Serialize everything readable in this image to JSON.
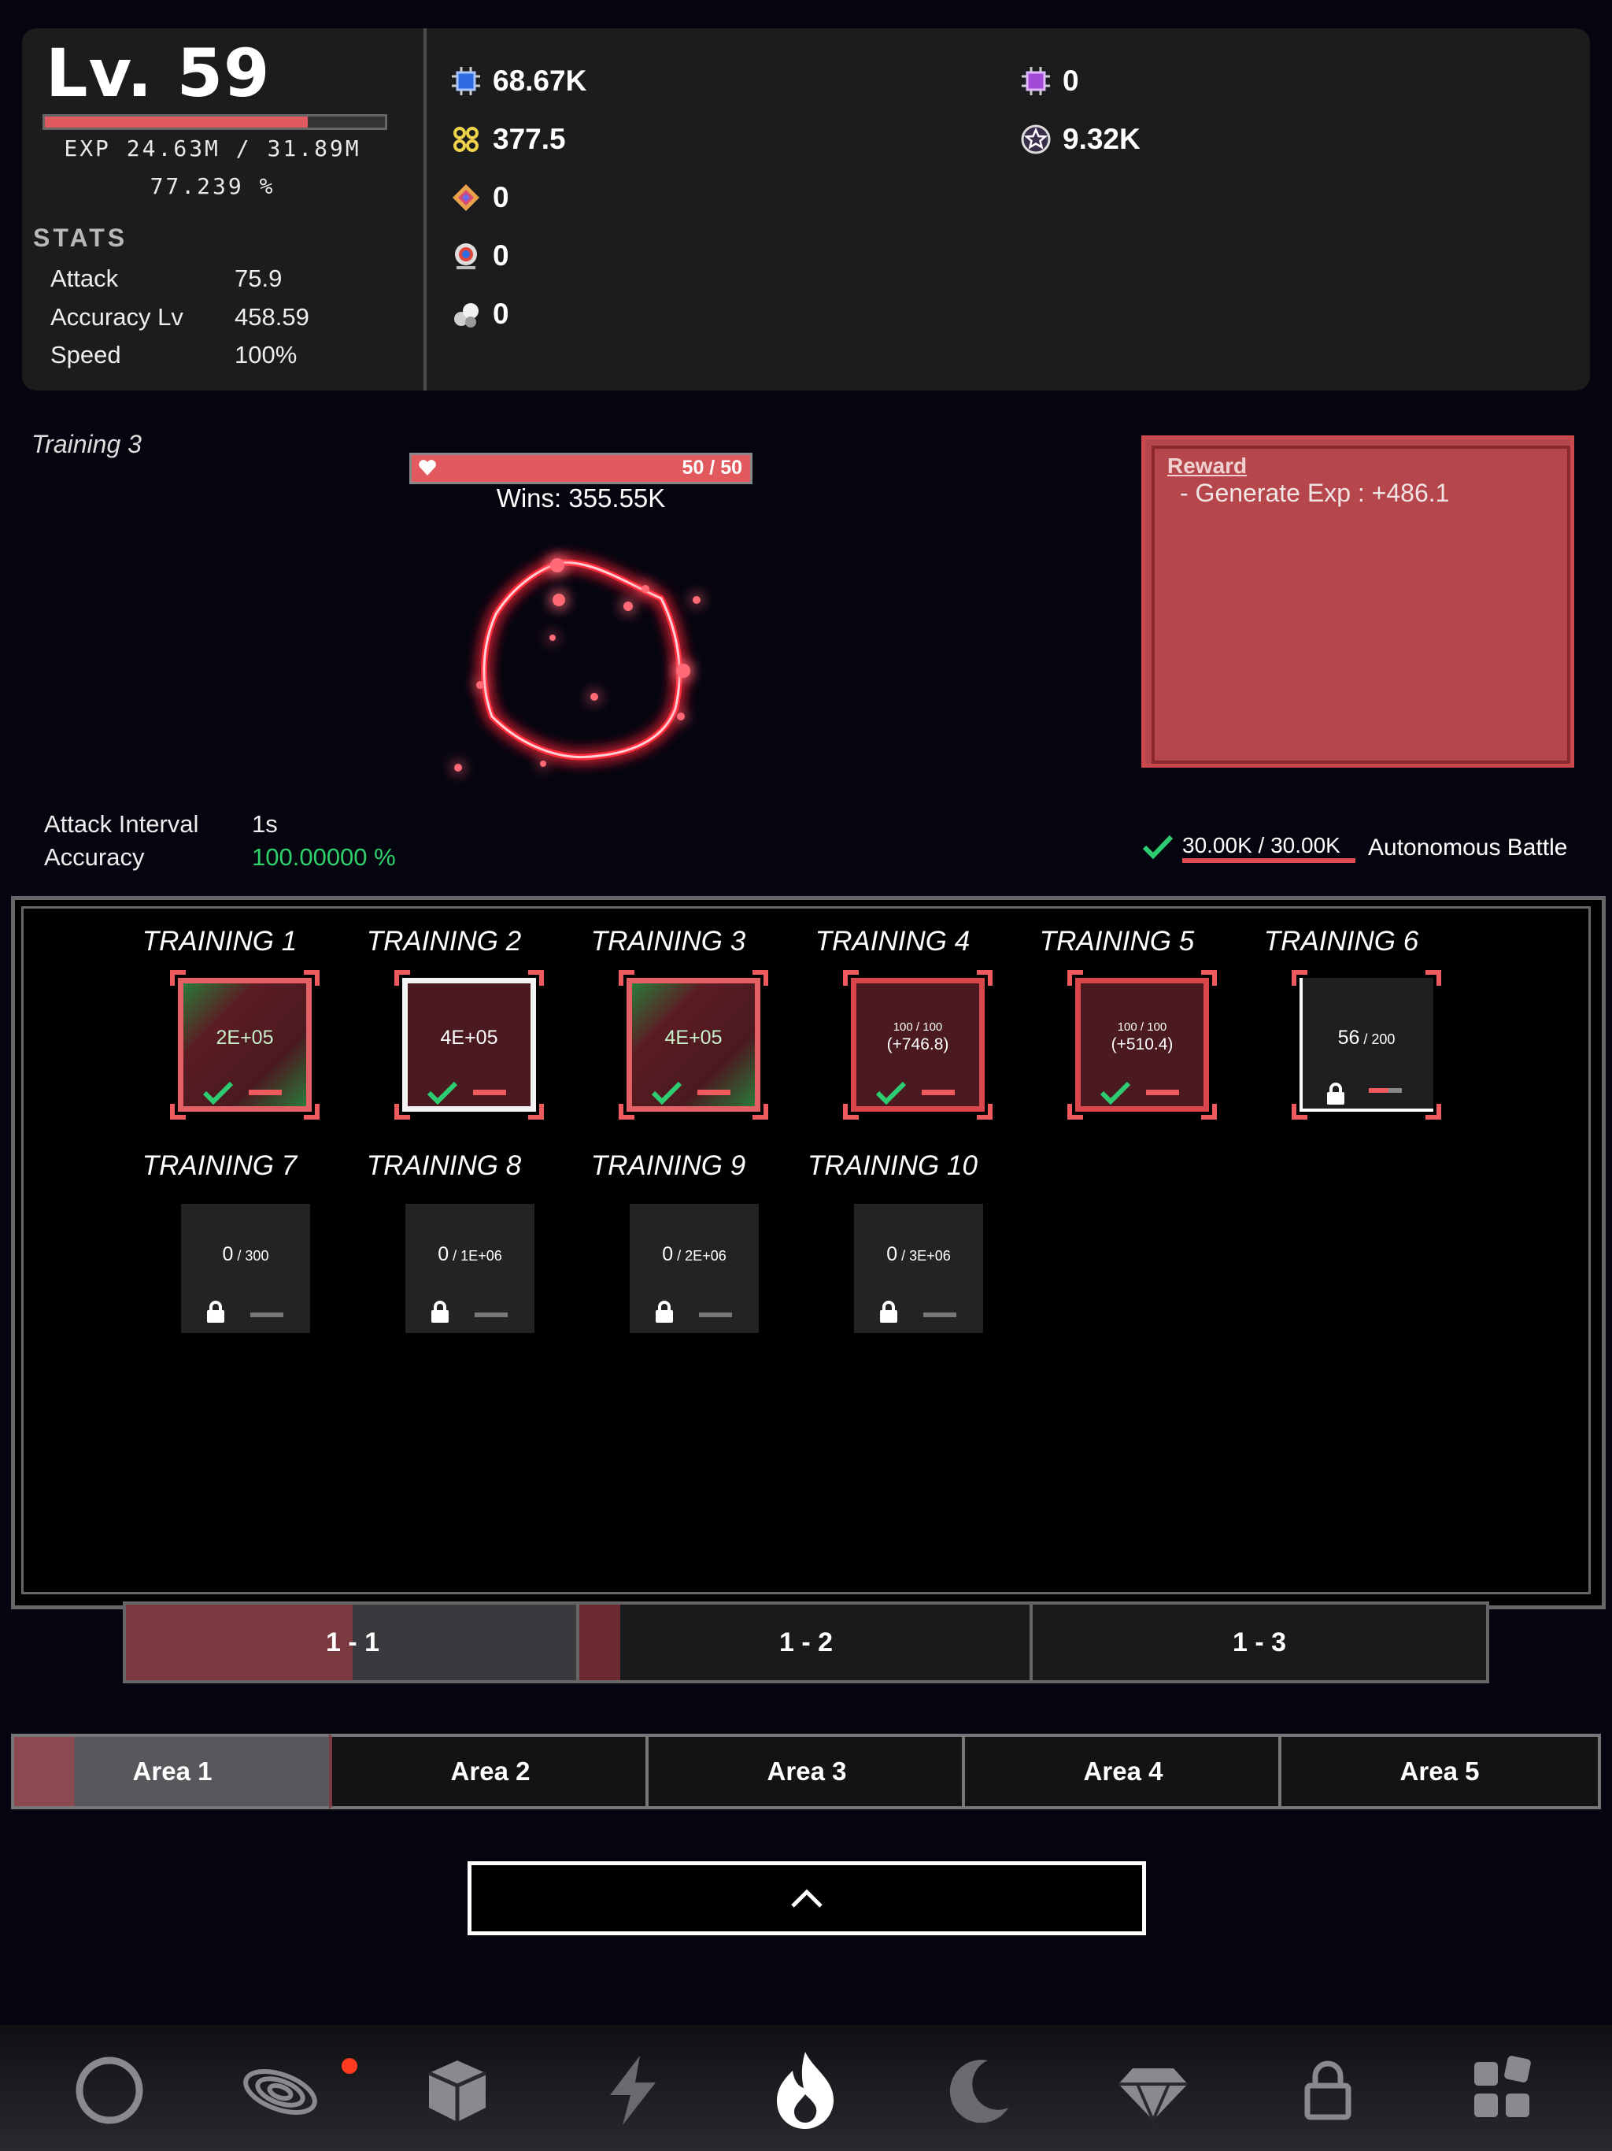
{
  "player": {
    "level": "Lv. 59",
    "exp_progress": 0.772,
    "exp_text": "EXP 24.63M / 31.89M",
    "exp_percent": "77.239 %"
  },
  "stats": {
    "title": "STATS",
    "items": [
      {
        "name": "Attack",
        "value": "75.9"
      },
      {
        "name": "Accuracy Lv",
        "value": "458.59"
      },
      {
        "name": "Speed",
        "value": "100%"
      }
    ]
  },
  "resources": [
    {
      "icon": "blue-chip-icon",
      "value": "68.67K"
    },
    {
      "icon": "gold-orbs-icon",
      "value": "377.5"
    },
    {
      "icon": "diamond-gem-icon",
      "value": "0"
    },
    {
      "icon": "eye-orb-icon",
      "value": "0"
    },
    {
      "icon": "white-orbs-icon",
      "value": "0"
    },
    {
      "icon": "purple-chip-icon",
      "value": "0"
    },
    {
      "icon": "star-coin-icon",
      "value": "9.32K"
    }
  ],
  "battle": {
    "training_name": "Training 3",
    "hp": "50 / 50",
    "hp_fraction": 1.0,
    "wins": "Wins: 355.55K",
    "attack_interval_label": "Attack Interval",
    "attack_interval": "1s",
    "accuracy_label": "Accuracy",
    "accuracy": "100.00000 %",
    "autonomous_progress": "30.00K / 30.00K",
    "autonomous_label": "Autonomous Battle"
  },
  "reward": {
    "title": "Reward",
    "line": " - Generate Exp : +486.1"
  },
  "trainings": [
    {
      "label": "TRAINING 1",
      "text": "2E+05",
      "state": "done-green"
    },
    {
      "label": "TRAINING 2",
      "text": "4E+05",
      "state": "done-white"
    },
    {
      "label": "TRAINING 3",
      "text": "4E+05",
      "state": "done-green"
    },
    {
      "label": "TRAINING 4",
      "small": "100 / 100",
      "text": "(+746.8)",
      "state": "done-red"
    },
    {
      "label": "TRAINING 5",
      "small": "100 / 100",
      "text": "(+510.4)",
      "state": "done-red"
    },
    {
      "label": "TRAINING 6",
      "text": "56",
      "small": " / 200",
      "state": "progress"
    },
    {
      "label": "TRAINING 7",
      "text": "0",
      "small": " / 300",
      "state": "locked"
    },
    {
      "label": "TRAINING 8",
      "text": "0",
      "small": " / 1E+06",
      "state": "locked"
    },
    {
      "label": "TRAINING 9",
      "text": "0",
      "small": " / 2E+06",
      "state": "locked"
    },
    {
      "label": "TRAINING 10",
      "text": "0",
      "small": " / 3E+06",
      "state": "locked"
    }
  ],
  "subtabs": [
    "1 - 1",
    "1 - 2",
    "1 - 3"
  ],
  "areas": [
    "Area 1",
    "Area 2",
    "Area 3",
    "Area 4",
    "Area 5"
  ],
  "nav_icons": [
    "ring-icon",
    "galaxy-icon",
    "cube-icon",
    "lightning-icon",
    "flame-icon",
    "moon-icon",
    "gem-icon",
    "lock-icon",
    "grid-icon"
  ],
  "colors": {
    "accent_red": "#e0595e",
    "success_green": "#2ecc71",
    "notification": "#ff3b1f"
  }
}
